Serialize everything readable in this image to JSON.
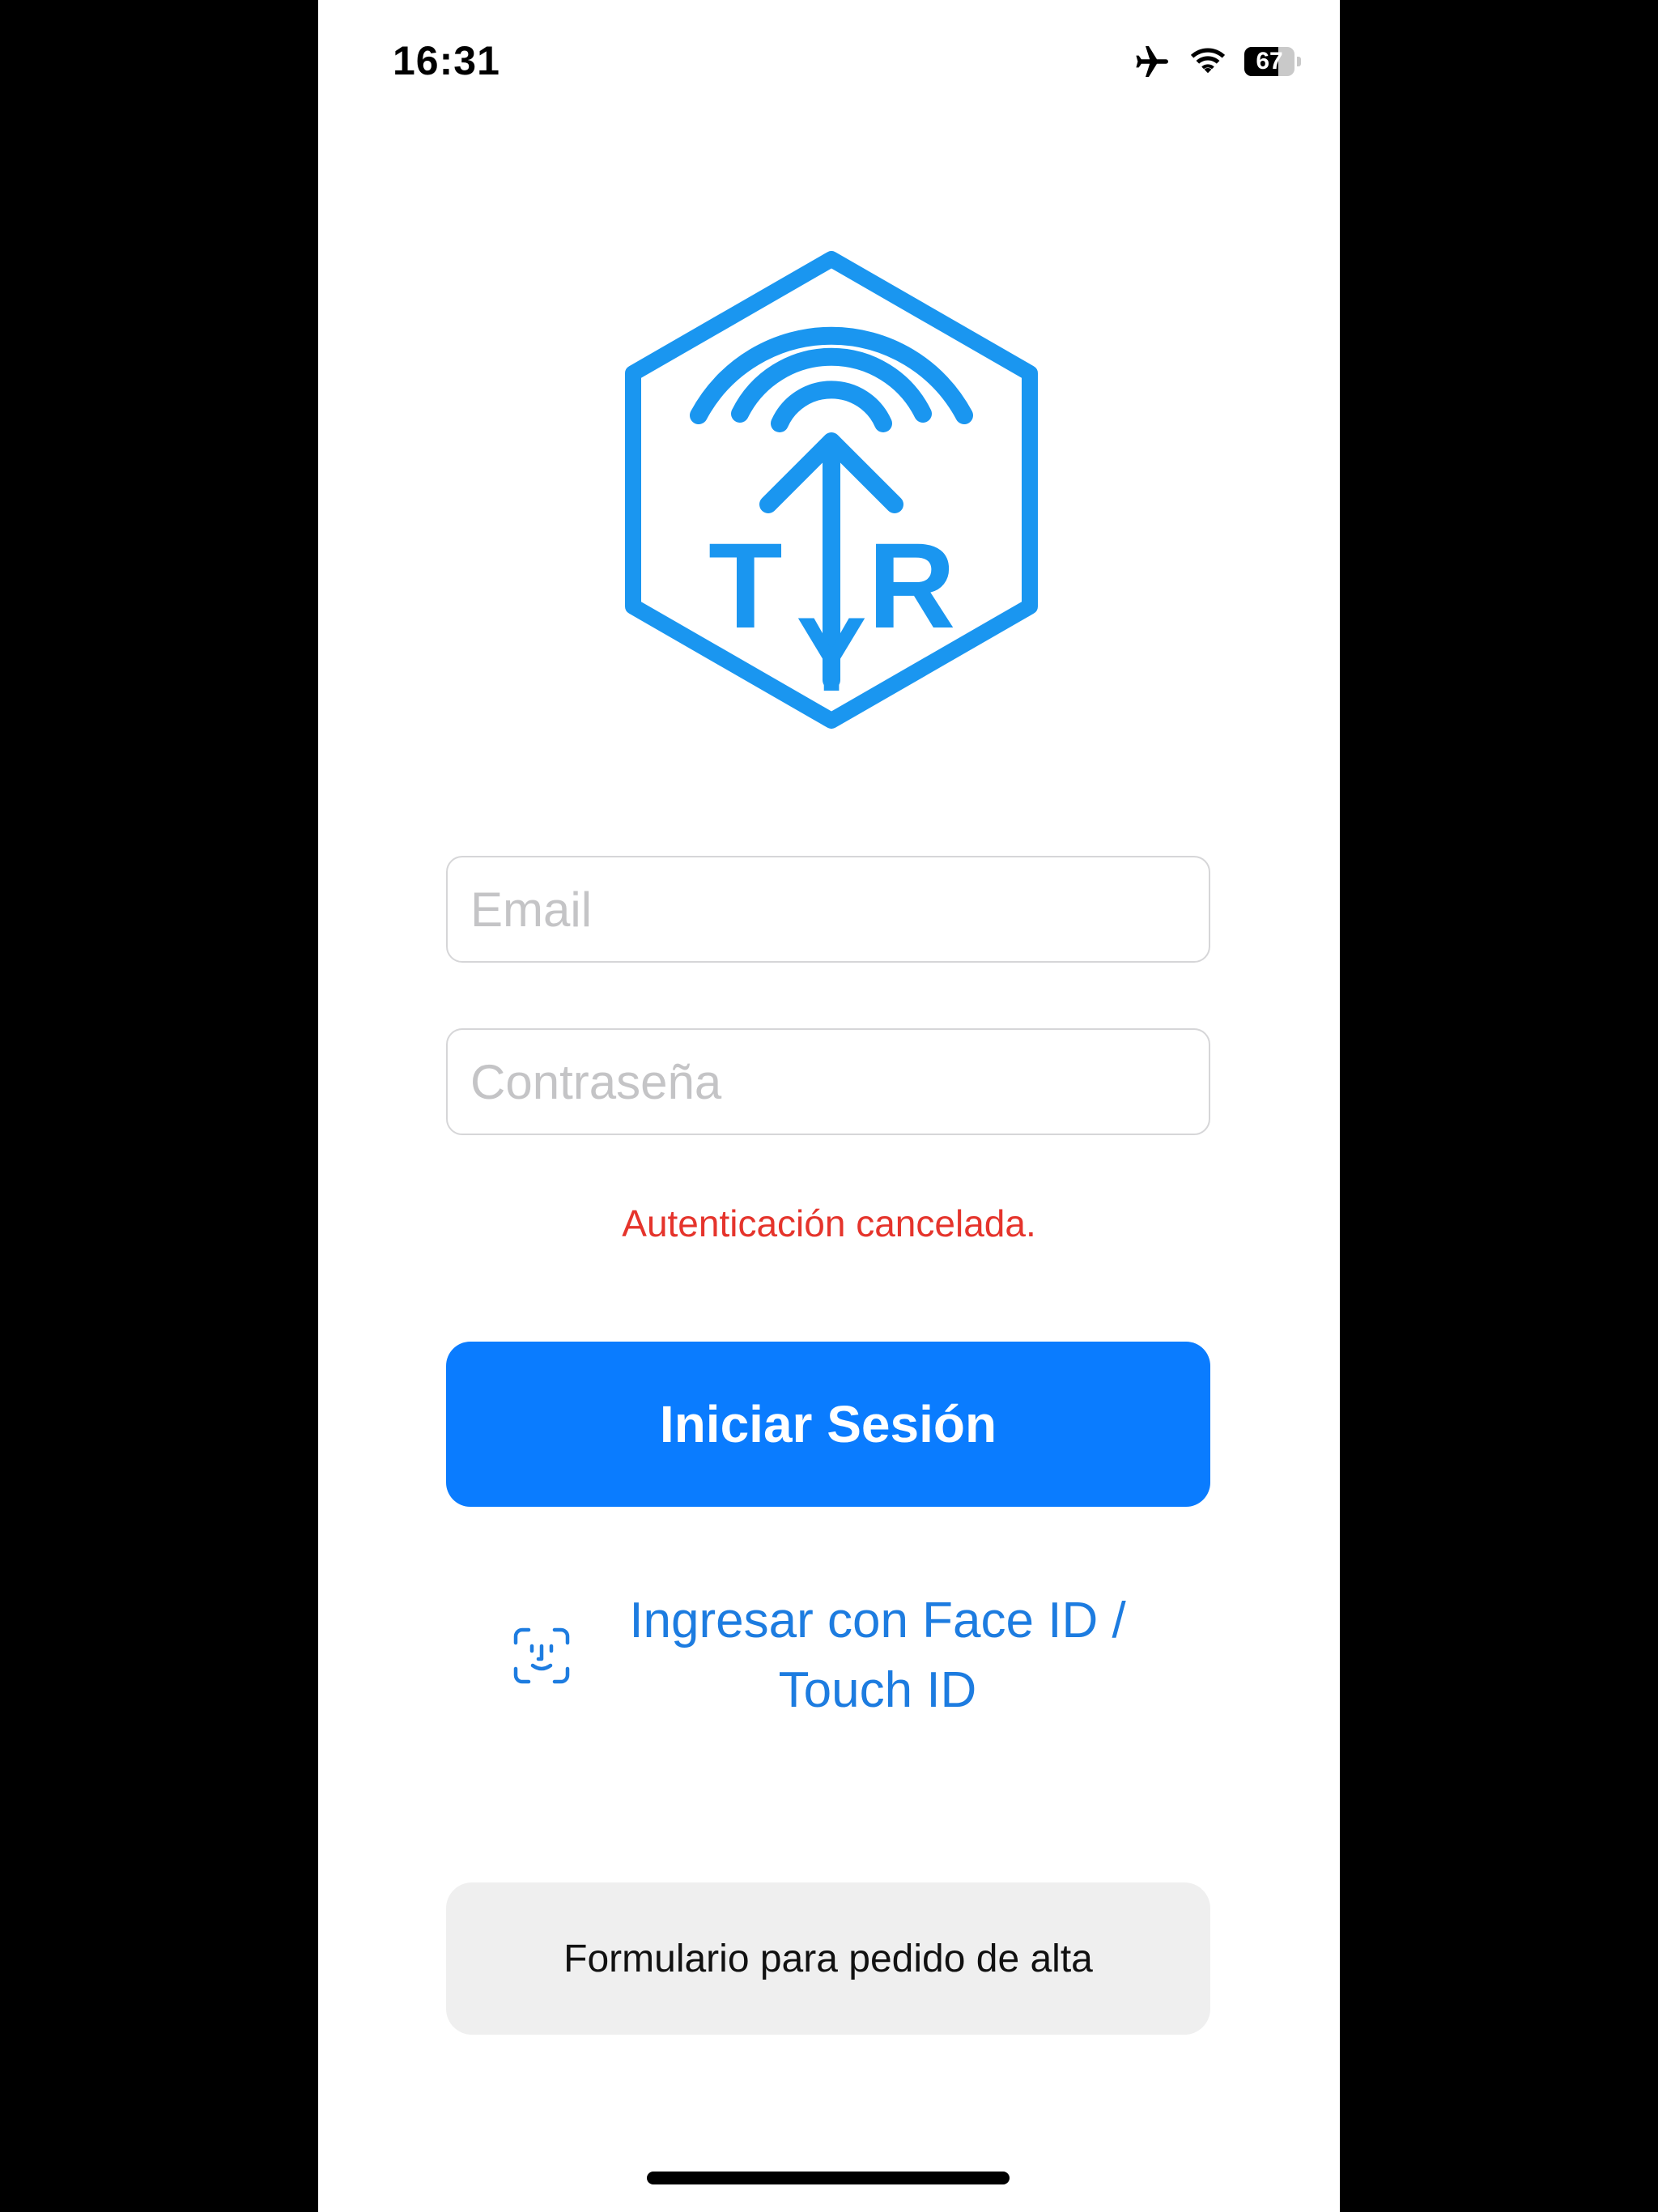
{
  "status_bar": {
    "time": "16:31",
    "battery_level": "67",
    "battery_fraction": 0.67,
    "icons": [
      "airplane-icon",
      "wifi-icon",
      "battery-icon"
    ]
  },
  "logo": {
    "text_left": "T",
    "text_center": "Y",
    "text_right": "R",
    "color": "#1a96f0"
  },
  "login_form": {
    "email_placeholder": "Email",
    "email_value": "",
    "password_placeholder": "Contraseña",
    "password_value": "",
    "error_message": "Autenticación cancelada.",
    "login_button_label": "Iniciar Sesión",
    "biometric_line1": "Ingresar con Face ID /",
    "biometric_line2": "Touch ID",
    "signup_button_label": "Formulario para pedido de alta"
  },
  "colors": {
    "primary_button": "#0a7cff",
    "link": "#1d7ce0",
    "error": "#e5342c",
    "secondary_button": "#efefef"
  }
}
